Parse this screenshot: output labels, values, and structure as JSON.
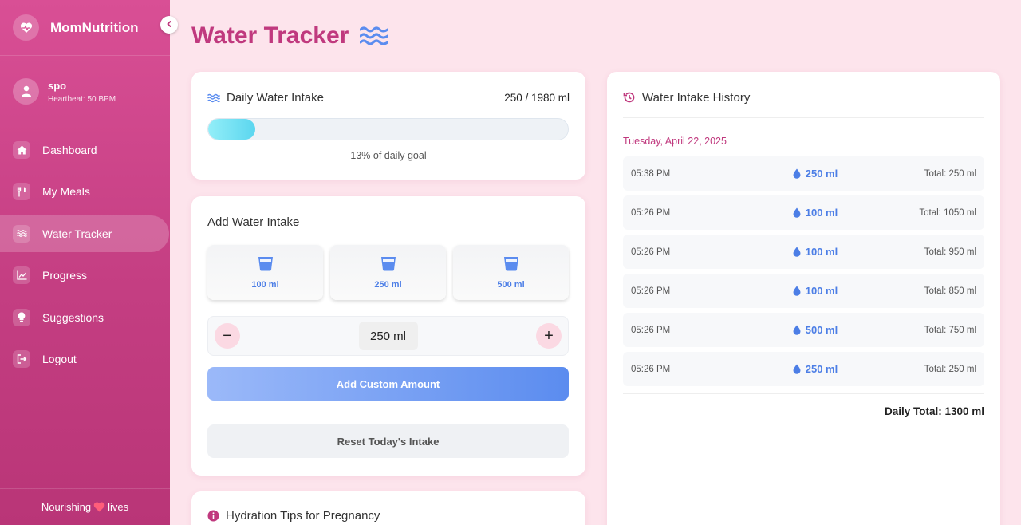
{
  "app": {
    "name": "MomNutrition"
  },
  "user": {
    "name": "spo",
    "status": "Heartbeat: 50 BPM"
  },
  "nav": [
    {
      "label": "Dashboard",
      "icon": "home-icon",
      "active": false
    },
    {
      "label": "My Meals",
      "icon": "utensils-icon",
      "active": false
    },
    {
      "label": "Water Tracker",
      "icon": "water-icon",
      "active": true
    },
    {
      "label": "Progress",
      "icon": "chart-line-icon",
      "active": false
    },
    {
      "label": "Suggestions",
      "icon": "lightbulb-icon",
      "active": false
    },
    {
      "label": "Logout",
      "icon": "logout-icon",
      "active": false
    }
  ],
  "footer": {
    "before": "Nourishing",
    "after": "lives"
  },
  "page": {
    "title": "Water Tracker"
  },
  "intake": {
    "title": "Daily Water Intake",
    "amount": "250 / 1980 ml",
    "progress_fraction": 0.13,
    "progress_text": "13% of daily goal"
  },
  "add": {
    "title": "Add Water Intake",
    "presets": [
      "100 ml",
      "250 ml",
      "500 ml"
    ],
    "minus": "−",
    "plus": "+",
    "custom_value": "250 ml",
    "custom_button": "Add Custom Amount",
    "reset_button": "Reset Today's Intake"
  },
  "tips": {
    "title": "Hydration Tips for Pregnancy"
  },
  "history": {
    "title": "Water Intake History",
    "date": "Tuesday, April 22, 2025",
    "entries": [
      {
        "time": "05:38 PM",
        "amount": "250 ml",
        "total": "Total: 250 ml"
      },
      {
        "time": "05:26 PM",
        "amount": "100 ml",
        "total": "Total: 1050 ml"
      },
      {
        "time": "05:26 PM",
        "amount": "100 ml",
        "total": "Total: 950 ml"
      },
      {
        "time": "05:26 PM",
        "amount": "100 ml",
        "total": "Total: 850 ml"
      },
      {
        "time": "05:26 PM",
        "amount": "500 ml",
        "total": "Total: 750 ml"
      },
      {
        "time": "05:26 PM",
        "amount": "250 ml",
        "total": "Total: 250 ml"
      }
    ],
    "daily_total": "Daily Total: 1300 ml"
  },
  "colors": {
    "accent": "#c0397e",
    "sidebar": "#d94f95",
    "water_blue": "#4c7ee6",
    "background": "#fde4ec"
  }
}
